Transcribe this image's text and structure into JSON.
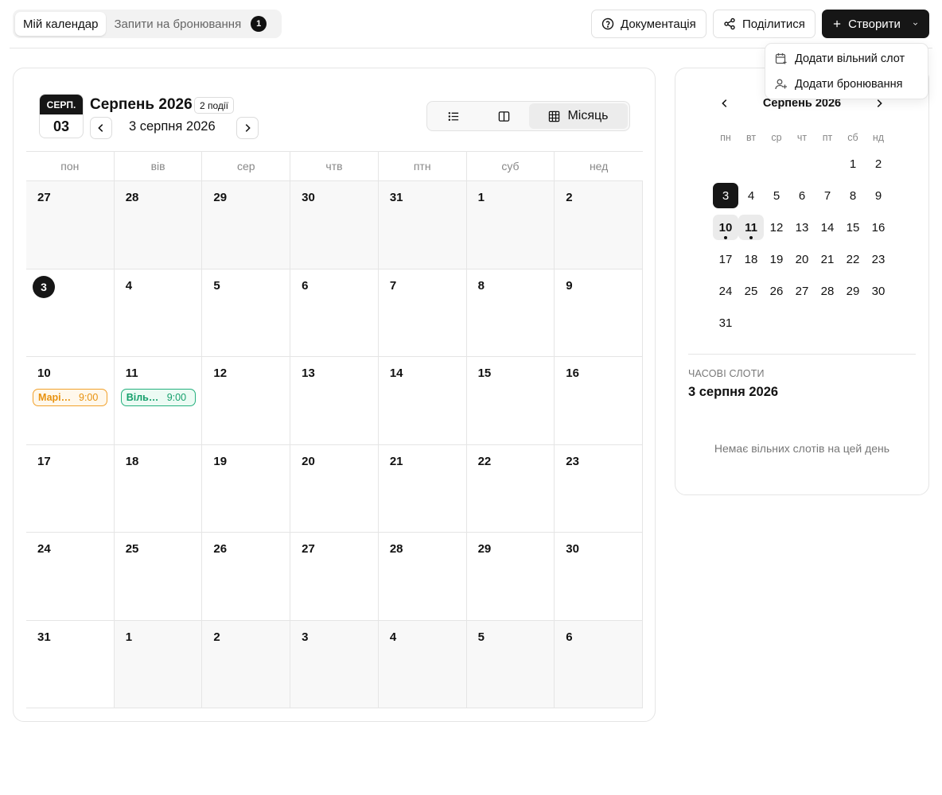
{
  "header": {
    "tabs": [
      {
        "label": "Мій календар",
        "active": true
      },
      {
        "label": "Запити на бронювання",
        "badge": "1"
      }
    ],
    "docs_label": "Документація",
    "share_label": "Поділитися",
    "create_label": "Створити"
  },
  "dropdown": {
    "items": [
      {
        "label": "Додати вільний слот",
        "icon": "calendar-plus-icon"
      },
      {
        "label": "Додати бронювання",
        "icon": "user-plus-icon"
      }
    ]
  },
  "calendar": {
    "badge_month": "СЕРП.",
    "badge_day": "03",
    "title": "Серпень 2026",
    "events_count": "2 події",
    "current_date": "3 серпня 2026",
    "views": [
      {
        "icon": "list-icon"
      },
      {
        "icon": "columns-icon"
      },
      {
        "icon": "grid-icon",
        "label": "Місяць",
        "active": true
      }
    ],
    "weekdays": [
      "пон",
      "вів",
      "сер",
      "чтв",
      "птн",
      "суб",
      "нед"
    ],
    "weeks": [
      [
        {
          "d": "27",
          "muted": true
        },
        {
          "d": "28",
          "muted": true
        },
        {
          "d": "29",
          "muted": true
        },
        {
          "d": "30",
          "muted": true
        },
        {
          "d": "31",
          "muted": true
        },
        {
          "d": "1",
          "muted": true
        },
        {
          "d": "2",
          "muted": true
        }
      ],
      [
        {
          "d": "3",
          "today": true
        },
        {
          "d": "4"
        },
        {
          "d": "5"
        },
        {
          "d": "6"
        },
        {
          "d": "7"
        },
        {
          "d": "8"
        },
        {
          "d": "9"
        }
      ],
      [
        {
          "d": "10",
          "event": {
            "name": "Марія ...",
            "time": "9:00",
            "color": "orange"
          }
        },
        {
          "d": "11",
          "event": {
            "name": "Вільний",
            "time": "9:00",
            "color": "green"
          }
        },
        {
          "d": "12"
        },
        {
          "d": "13"
        },
        {
          "d": "14"
        },
        {
          "d": "15"
        },
        {
          "d": "16"
        }
      ],
      [
        {
          "d": "17"
        },
        {
          "d": "18"
        },
        {
          "d": "19"
        },
        {
          "d": "20"
        },
        {
          "d": "21"
        },
        {
          "d": "22"
        },
        {
          "d": "23"
        }
      ],
      [
        {
          "d": "24"
        },
        {
          "d": "25"
        },
        {
          "d": "26"
        },
        {
          "d": "27"
        },
        {
          "d": "28"
        },
        {
          "d": "29"
        },
        {
          "d": "30"
        }
      ],
      [
        {
          "d": "31"
        },
        {
          "d": "1",
          "muted": true
        },
        {
          "d": "2",
          "muted": true
        },
        {
          "d": "3",
          "muted": true
        },
        {
          "d": "4",
          "muted": true
        },
        {
          "d": "5",
          "muted": true
        },
        {
          "d": "6",
          "muted": true
        }
      ]
    ]
  },
  "mini_calendar": {
    "title": "Серпень 2026",
    "weekdays": [
      "пн",
      "вт",
      "ср",
      "чт",
      "пт",
      "сб",
      "нд"
    ],
    "days": [
      {
        "d": ""
      },
      {
        "d": ""
      },
      {
        "d": ""
      },
      {
        "d": ""
      },
      {
        "d": ""
      },
      {
        "d": "1"
      },
      {
        "d": "2"
      },
      {
        "d": "3",
        "selected": true
      },
      {
        "d": "4"
      },
      {
        "d": "5"
      },
      {
        "d": "6"
      },
      {
        "d": "7"
      },
      {
        "d": "8"
      },
      {
        "d": "9"
      },
      {
        "d": "10",
        "event": true
      },
      {
        "d": "11",
        "event": true
      },
      {
        "d": "12"
      },
      {
        "d": "13"
      },
      {
        "d": "14"
      },
      {
        "d": "15"
      },
      {
        "d": "16"
      },
      {
        "d": "17"
      },
      {
        "d": "18"
      },
      {
        "d": "19"
      },
      {
        "d": "20"
      },
      {
        "d": "21"
      },
      {
        "d": "22"
      },
      {
        "d": "23"
      },
      {
        "d": "24"
      },
      {
        "d": "25"
      },
      {
        "d": "26"
      },
      {
        "d": "27"
      },
      {
        "d": "28"
      },
      {
        "d": "29"
      },
      {
        "d": "30"
      },
      {
        "d": "31"
      }
    ]
  },
  "slots": {
    "label": "ЧАСОВІ СЛОТИ",
    "date": "3 серпня 2026",
    "empty_text": "Немає вільних слотів на цей день"
  },
  "colors": {
    "accent": "#161616",
    "event_orange": "#f2a12b",
    "event_green": "#23b07d"
  }
}
